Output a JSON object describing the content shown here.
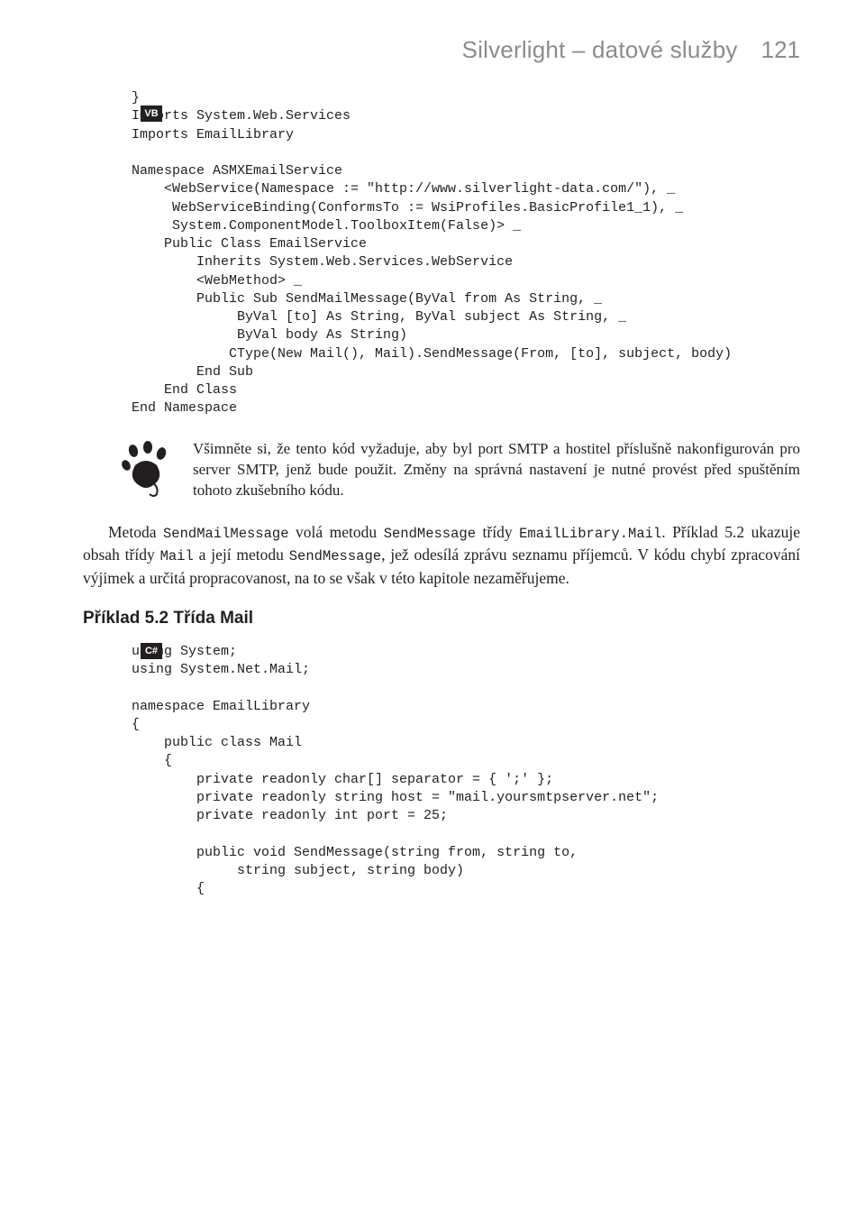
{
  "header": {
    "title": "Silverlight – datové služby",
    "page": "121"
  },
  "vb": {
    "lang_label": "VB",
    "code": "}\nImports System.Web.Services\nImports EmailLibrary\n\nNamespace ASMXEmailService\n    <WebService(Namespace := \"http://www.silverlight-data.com/\"), _\n     WebServiceBinding(ConformsTo := WsiProfiles.BasicProfile1_1), _\n     System.ComponentModel.ToolboxItem(False)> _\n    Public Class EmailService\n        Inherits System.Web.Services.WebService\n        <WebMethod> _\n        Public Sub SendMailMessage(ByVal from As String, _\n             ByVal [to] As String, ByVal subject As String, _\n             ByVal body As String)\n            CType(New Mail(), Mail).SendMessage(From, [to], subject, body)\n        End Sub\n    End Class\nEnd Namespace"
  },
  "note": {
    "text": "Všimněte si, že tento kód vyžaduje, aby byl port SMTP a hostitel příslušně nakonfigurován pro server SMTP, jenž bude použit. Změny na správná nastavení je nutné provést před spuštěním tohoto zkušebního kódu."
  },
  "para": {
    "a": "Metoda ",
    "m1": "SendMailMessage",
    "b": " volá metodu ",
    "m2": "SendMessage",
    "c": " třídy ",
    "m3": "EmailLibrary.Mail",
    "d": ". Příklad 5.2 ukazuje obsah třídy ",
    "m4": "Mail",
    "e": " a její metodu ",
    "m5": "SendMessage",
    "f": ", jež odesílá zprávu seznamu příjemců. V kódu chybí zpracování výjimek a určitá propracovanost, na to se však v této kapitole nezaměřujeme."
  },
  "example_heading": "Příklad 5.2 Třída Mail",
  "cs": {
    "lang_label": "C#",
    "code": "using System;\nusing System.Net.Mail;\n\nnamespace EmailLibrary\n{\n    public class Mail\n    {\n        private readonly char[] separator = { ';' };\n        private readonly string host = \"mail.yoursmtpserver.net\";\n        private readonly int port = 25;\n\n        public void SendMessage(string from, string to,\n             string subject, string body)\n        {"
  }
}
